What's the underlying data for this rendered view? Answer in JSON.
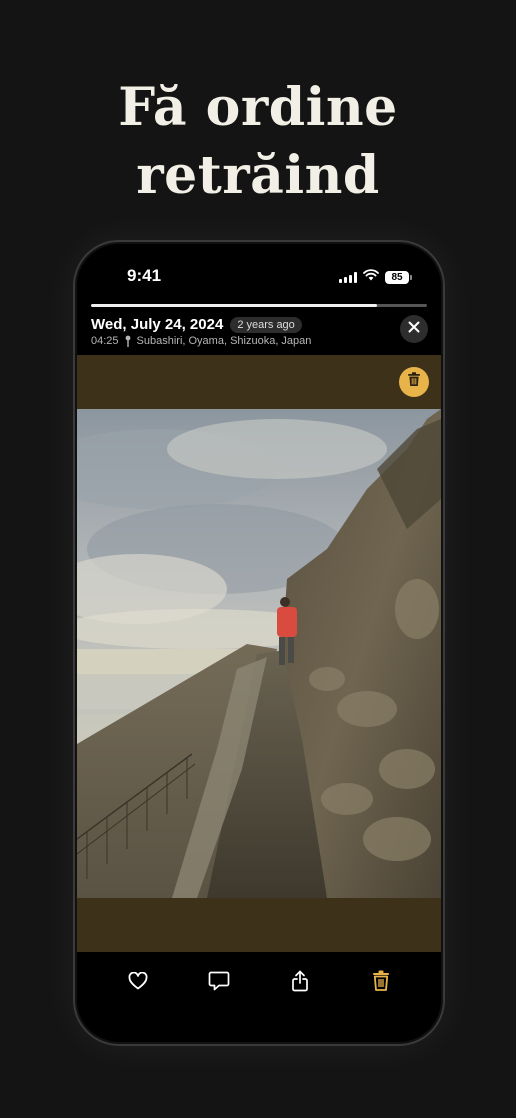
{
  "headline": {
    "line1": "Fă ordine",
    "line2": "retrăind"
  },
  "status_bar": {
    "time": "9:41",
    "battery": "85",
    "icons": [
      "signal-icon",
      "wifi-icon",
      "battery-icon"
    ]
  },
  "progress": {
    "value": 0.85
  },
  "header": {
    "date": "Wed, July 24, 2024",
    "ago": "2 years ago",
    "time": "04:25",
    "location": "Subashiri, Oyama, Shizuoka, Japan",
    "close_icon": "close-icon"
  },
  "media": {
    "delete_icon": "trash-icon"
  },
  "toolbar": {
    "items": [
      "heart-icon",
      "comment-icon",
      "share-icon",
      "trash-icon"
    ]
  },
  "colors": {
    "background": "#141414",
    "accent": "#e8b44a",
    "media_bg": "#3d311a"
  }
}
